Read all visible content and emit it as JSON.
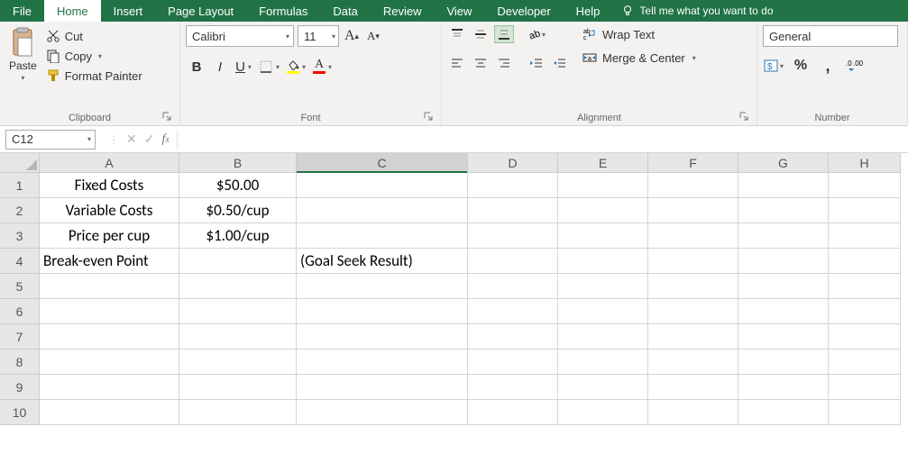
{
  "tabs": [
    "File",
    "Home",
    "Insert",
    "Page Layout",
    "Formulas",
    "Data",
    "Review",
    "View",
    "Developer",
    "Help"
  ],
  "tell_me": "Tell me what you want to do",
  "clipboard": {
    "paste": "Paste",
    "cut": "Cut",
    "copy": "Copy",
    "format_painter": "Format Painter",
    "label": "Clipboard"
  },
  "font": {
    "name": "Calibri",
    "size": "11",
    "label": "Font"
  },
  "alignment": {
    "wrap": "Wrap Text",
    "merge": "Merge & Center",
    "label": "Alignment"
  },
  "number": {
    "format": "General",
    "label": "Number"
  },
  "name_box": "C12",
  "col_headers": [
    "A",
    "B",
    "C",
    "D",
    "E",
    "F",
    "G",
    "H"
  ],
  "row_headers": [
    "1",
    "2",
    "3",
    "4",
    "5",
    "6",
    "7",
    "8",
    "9",
    "10"
  ],
  "cells": {
    "A1": "Fixed Costs",
    "B1": "$50.00",
    "A2": "Variable Costs",
    "B2": "$0.50/cup",
    "A3": "Price per cup",
    "B3": "$1.00/cup",
    "A4": "Break-even Point",
    "C4": "(Goal Seek Result)"
  },
  "active_cell": "C12",
  "chart_data": null
}
